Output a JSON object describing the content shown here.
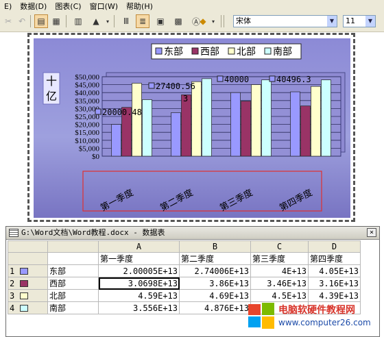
{
  "menu": [
    "E)",
    "数据(D)",
    "图表(C)",
    "窗口(W)",
    "帮助(H)"
  ],
  "toolbar": {
    "font_name": "宋体",
    "font_size": "11"
  },
  "chart": {
    "y_axis_title": "十亿",
    "legend": [
      "东部",
      "西部",
      "北部",
      "南部"
    ],
    "categories": [
      "第一季度",
      "第二季度",
      "第三季度",
      "第四季度"
    ],
    "y_ticks": [
      "$50,000",
      "$45,000",
      "$40,000",
      "$35,000",
      "$30,000",
      "$25,000",
      "$20,000",
      "$15,000",
      "$10,000",
      "$5,000",
      "$0"
    ],
    "data_labels": [
      "20000.48",
      "27400.56",
      "3",
      "40000",
      "40496.3"
    ]
  },
  "chart_data": {
    "type": "bar",
    "categories": [
      "第一季度",
      "第二季度",
      "第三季度",
      "第四季度"
    ],
    "series": [
      {
        "name": "东部",
        "values": [
          20000.48,
          27400.56,
          40000,
          40496.3
        ]
      },
      {
        "name": "西部",
        "values": [
          30698,
          38600,
          34600,
          31600
        ]
      },
      {
        "name": "北部",
        "values": [
          45900,
          46900,
          45000,
          43900
        ]
      },
      {
        "name": "南部",
        "values": [
          35560,
          48760,
          48000,
          48000
        ]
      }
    ],
    "ylabel": "十亿",
    "ylim": [
      0,
      50000
    ],
    "colors": [
      "#9999ff",
      "#993366",
      "#ffffcc",
      "#ccffff"
    ],
    "legend_position": "top"
  },
  "datasheet": {
    "title": "G:\\Word文档\\Word教程.docx - 数据表",
    "close_label": "×",
    "col_letters": [
      "A",
      "B",
      "C",
      "D"
    ],
    "col_headers": [
      "第一季度",
      "第二季度",
      "第三季度",
      "第四季度"
    ],
    "rows": [
      {
        "num": "1",
        "name": "东部",
        "cells": [
          "2.00005E+13",
          "2.74006E+13",
          "4E+13",
          "4.05E+13"
        ]
      },
      {
        "num": "2",
        "name": "西部",
        "cells": [
          "3.0698E+13",
          "3.86E+13",
          "3.46E+13",
          "3.16E+13"
        ]
      },
      {
        "num": "3",
        "name": "北部",
        "cells": [
          "4.59E+13",
          "4.69E+13",
          "4.5E+13",
          "4.39E+13"
        ]
      },
      {
        "num": "4",
        "name": "南部",
        "cells": [
          "3.556E+13",
          "4.876E+13",
          "",
          ""
        ]
      }
    ]
  },
  "watermark": {
    "title": "电脑软硬件教程网",
    "url": "www.computer26.com"
  }
}
